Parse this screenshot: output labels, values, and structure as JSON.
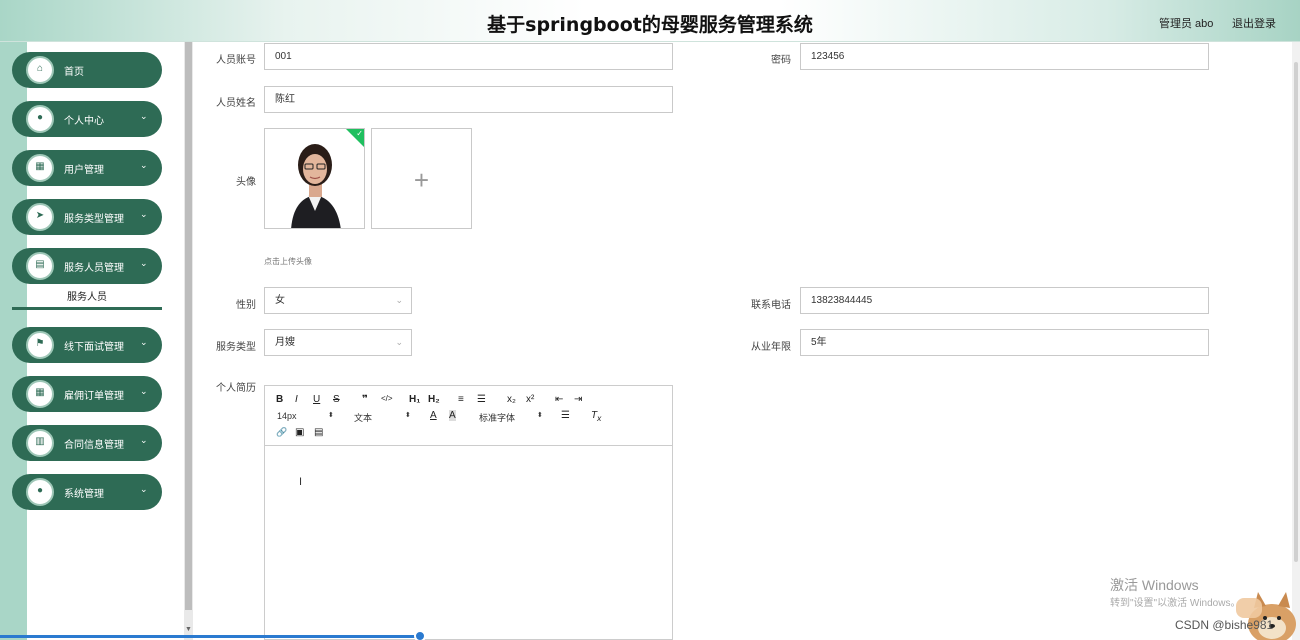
{
  "header": {
    "title": "基于springboot的母婴服务管理系统",
    "user": "管理员 abo",
    "logout": "退出登录"
  },
  "sidebar": {
    "items": [
      {
        "label": "首页",
        "icon": "home-icon",
        "glyph": "⌂",
        "has_children": false
      },
      {
        "label": "个人中心",
        "icon": "user-icon",
        "glyph": "●",
        "has_children": true
      },
      {
        "label": "用户管理",
        "icon": "grid-icon",
        "glyph": "▦",
        "has_children": true
      },
      {
        "label": "服务类型管理",
        "icon": "send-icon",
        "glyph": "➤",
        "has_children": true
      },
      {
        "label": "服务人员管理",
        "icon": "briefcase-icon",
        "glyph": "▤",
        "has_children": true
      },
      {
        "label": "线下面试管理",
        "icon": "flag-icon",
        "glyph": "⚑",
        "has_children": true
      },
      {
        "label": "雇佣订单管理",
        "icon": "grid-icon",
        "glyph": "▦",
        "has_children": true
      },
      {
        "label": "合同信息管理",
        "icon": "book-icon",
        "glyph": "▥",
        "has_children": true
      },
      {
        "label": "系统管理",
        "icon": "user-icon",
        "glyph": "●",
        "has_children": true
      }
    ],
    "sub_item": "服务人员",
    "chevron": "⌄"
  },
  "form": {
    "account_label": "人员账号",
    "account_value": "001",
    "password_label": "密码",
    "password_value": "123456",
    "name_label": "人员姓名",
    "name_value": "陈红",
    "avatar_label": "头像",
    "upload_hint": "点击上传头像",
    "gender_label": "性别",
    "gender_value": "女",
    "phone_label": "联系电话",
    "phone_value": "13823844445",
    "service_type_label": "服务类型",
    "service_type_value": "月嫂",
    "years_label": "从业年限",
    "years_value": "5年",
    "resume_label": "个人简历"
  },
  "editor": {
    "buttons_row1": [
      "B",
      "I",
      "U",
      "S",
      "❞",
      "</>",
      "H₁",
      "H₂",
      "≡",
      "☰",
      "x₂",
      "x²",
      "⇤",
      "⇥"
    ],
    "font_size": "14px",
    "text_style": "文本",
    "font_family": "标准字体",
    "buttons_row3": [
      "🔗",
      "▣",
      "▤"
    ]
  },
  "watermark": {
    "line1": "激活 Windows",
    "line2": "转到\"设置\"以激活 Windows。",
    "csdn": "CSDN @bishe981"
  },
  "colors": {
    "menu_bg": "#2e6b55",
    "accent_mint": "#a9d6c7",
    "upload_success": "#1fbf5f"
  }
}
